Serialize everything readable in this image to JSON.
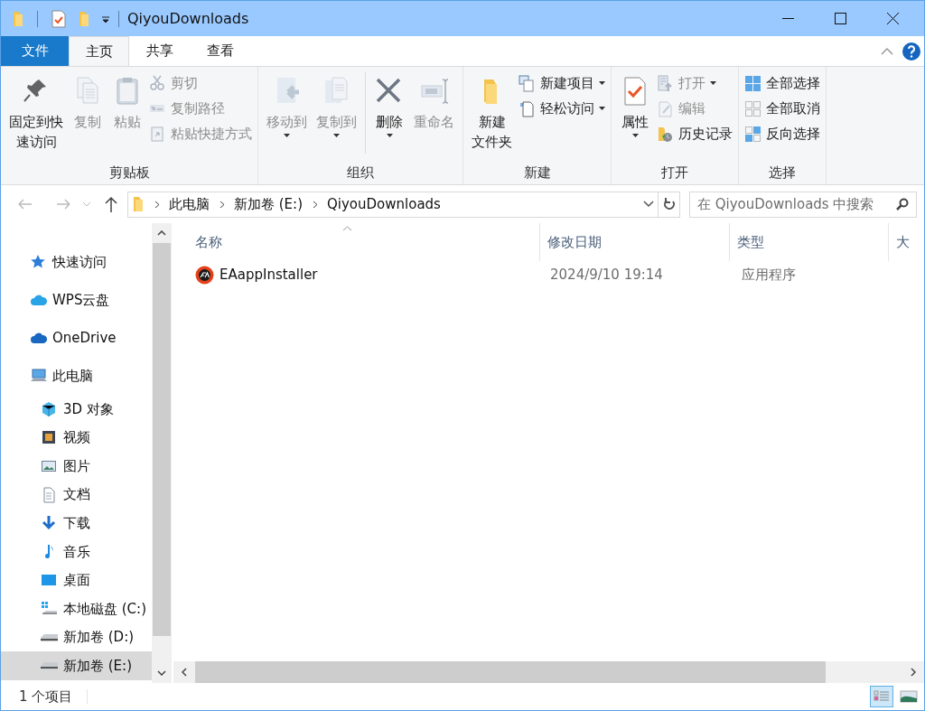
{
  "window": {
    "title": "QiyouDownloads"
  },
  "ribbon_tabs": [
    {
      "label": "文件",
      "kind": "file",
      "selected": false
    },
    {
      "label": "主页",
      "kind": "tab",
      "selected": true
    },
    {
      "label": "共享",
      "kind": "tab",
      "selected": false
    },
    {
      "label": "查看",
      "kind": "tab",
      "selected": false
    }
  ],
  "ribbon_groups": [
    {
      "label": "剪贴板",
      "items": [
        {
          "kind": "large",
          "lines": [
            "固定到快",
            "速访问"
          ],
          "disabled": false,
          "dropdown": false
        },
        {
          "kind": "large",
          "label": "复制",
          "disabled": true,
          "dropdown": false
        },
        {
          "kind": "large",
          "label": "粘贴",
          "disabled": true,
          "dropdown": false
        },
        {
          "kind": "stack",
          "items": [
            {
              "label": "剪切",
              "disabled": true,
              "dropdown": false
            },
            {
              "label": "复制路径",
              "disabled": true,
              "dropdown": false
            },
            {
              "label": "粘贴快捷方式",
              "disabled": true,
              "dropdown": false
            }
          ]
        }
      ]
    },
    {
      "label": "组织",
      "items": [
        {
          "kind": "large",
          "label": "移动到",
          "disabled": true,
          "dropdown": true
        },
        {
          "kind": "large",
          "label": "复制到",
          "disabled": true,
          "dropdown": true
        },
        {
          "kind": "separator"
        },
        {
          "kind": "large",
          "label": "删除",
          "disabled": false,
          "dropdown": true
        },
        {
          "kind": "large",
          "label": "重命名",
          "disabled": true,
          "dropdown": false
        }
      ]
    },
    {
      "label": "新建",
      "items": [
        {
          "kind": "large",
          "lines": [
            "新建",
            "文件夹"
          ],
          "disabled": false,
          "dropdown": false
        },
        {
          "kind": "stack",
          "items": [
            {
              "label": "新建项目",
              "disabled": false,
              "dropdown": true
            },
            {
              "label": "轻松访问",
              "disabled": false,
              "dropdown": true
            }
          ]
        }
      ]
    },
    {
      "label": "打开",
      "items": [
        {
          "kind": "large",
          "label": "属性",
          "disabled": false,
          "dropdown": true
        },
        {
          "kind": "stack",
          "items": [
            {
              "label": "打开",
              "disabled": true,
              "dropdown": true
            },
            {
              "label": "编辑",
              "disabled": true,
              "dropdown": false
            },
            {
              "label": "历史记录",
              "disabled": false,
              "dropdown": false
            }
          ]
        }
      ]
    },
    {
      "label": "选择",
      "items": [
        {
          "kind": "stack",
          "items": [
            {
              "label": "全部选择",
              "disabled": false,
              "dropdown": false
            },
            {
              "label": "全部取消",
              "disabled": false,
              "dropdown": false
            },
            {
              "label": "反向选择",
              "disabled": false,
              "dropdown": false
            }
          ]
        }
      ]
    }
  ],
  "address_bar": {
    "breadcrumbs": [
      "此电脑",
      "新加卷 (E:)",
      "QiyouDownloads"
    ]
  },
  "search": {
    "placeholder": "在 QiyouDownloads 中搜索"
  },
  "navigation": [
    {
      "label": "快速访问",
      "selected": false
    },
    {
      "label": "WPS云盘",
      "selected": false
    },
    {
      "label": "OneDrive",
      "selected": false
    },
    {
      "label": "此电脑",
      "selected": false,
      "children": [
        {
          "label": "3D 对象",
          "selected": false
        },
        {
          "label": "视频",
          "selected": false
        },
        {
          "label": "图片",
          "selected": false
        },
        {
          "label": "文档",
          "selected": false
        },
        {
          "label": "下载",
          "selected": false
        },
        {
          "label": "音乐",
          "selected": false
        },
        {
          "label": "桌面",
          "selected": false
        },
        {
          "label": "本地磁盘 (C:)",
          "selected": false
        },
        {
          "label": "新加卷 (D:)",
          "selected": false
        },
        {
          "label": "新加卷 (E:)",
          "selected": true
        }
      ]
    }
  ],
  "file_list": {
    "columns": [
      "名称",
      "修改日期",
      "类型",
      "大"
    ],
    "rows": [
      {
        "name": "EAappInstaller",
        "modified": "2024/9/10 19:14",
        "type": "应用程序"
      }
    ]
  },
  "status_bar": {
    "item_count": "1 个项目",
    "views": [
      {
        "selected": true
      },
      {
        "selected": false
      }
    ]
  }
}
